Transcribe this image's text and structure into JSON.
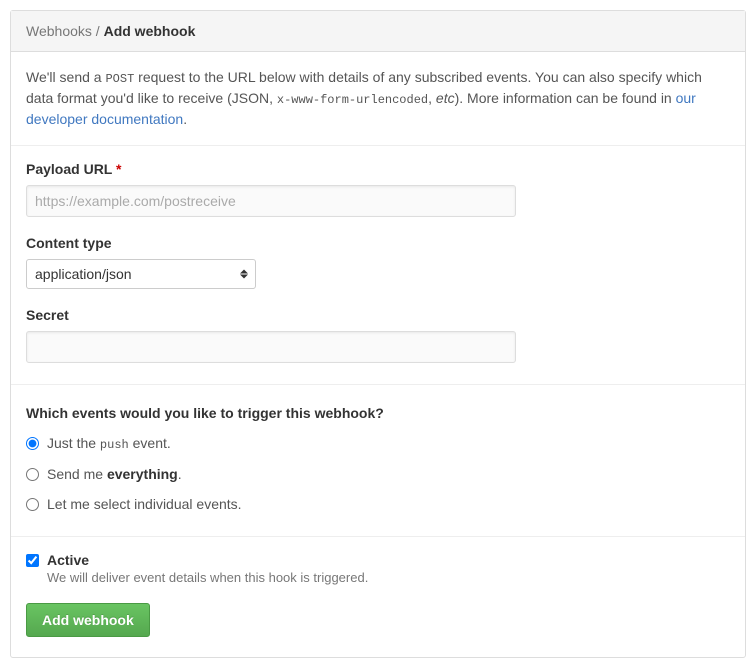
{
  "header": {
    "breadcrumb_parent": "Webhooks",
    "breadcrumb_current": "Add webhook"
  },
  "description": {
    "text1": "We'll send a ",
    "code1": "POST",
    "text2": " request to the URL below with details of any subscribed events. You can also specify which data format you'd like to receive (JSON, ",
    "code2": "x-www-form-urlencoded",
    "text3": ", ",
    "em": "etc",
    "text4": "). More information can be found in ",
    "link_text": "our developer documentation",
    "text5": "."
  },
  "form": {
    "payload_url": {
      "label": "Payload URL",
      "placeholder": "https://example.com/postreceive",
      "value": ""
    },
    "content_type": {
      "label": "Content type",
      "selected": "application/json"
    },
    "secret": {
      "label": "Secret",
      "value": ""
    }
  },
  "events": {
    "title": "Which events would you like to trigger this webhook?",
    "options": {
      "push": {
        "prefix": "Just the ",
        "code": "push",
        "suffix": " event."
      },
      "everything": {
        "prefix": "Send me ",
        "strong": "everything",
        "suffix": "."
      },
      "individual": {
        "text": "Let me select individual events."
      }
    }
  },
  "active": {
    "label": "Active",
    "description": "We will deliver event details when this hook is triggered."
  },
  "submit": {
    "label": "Add webhook"
  }
}
